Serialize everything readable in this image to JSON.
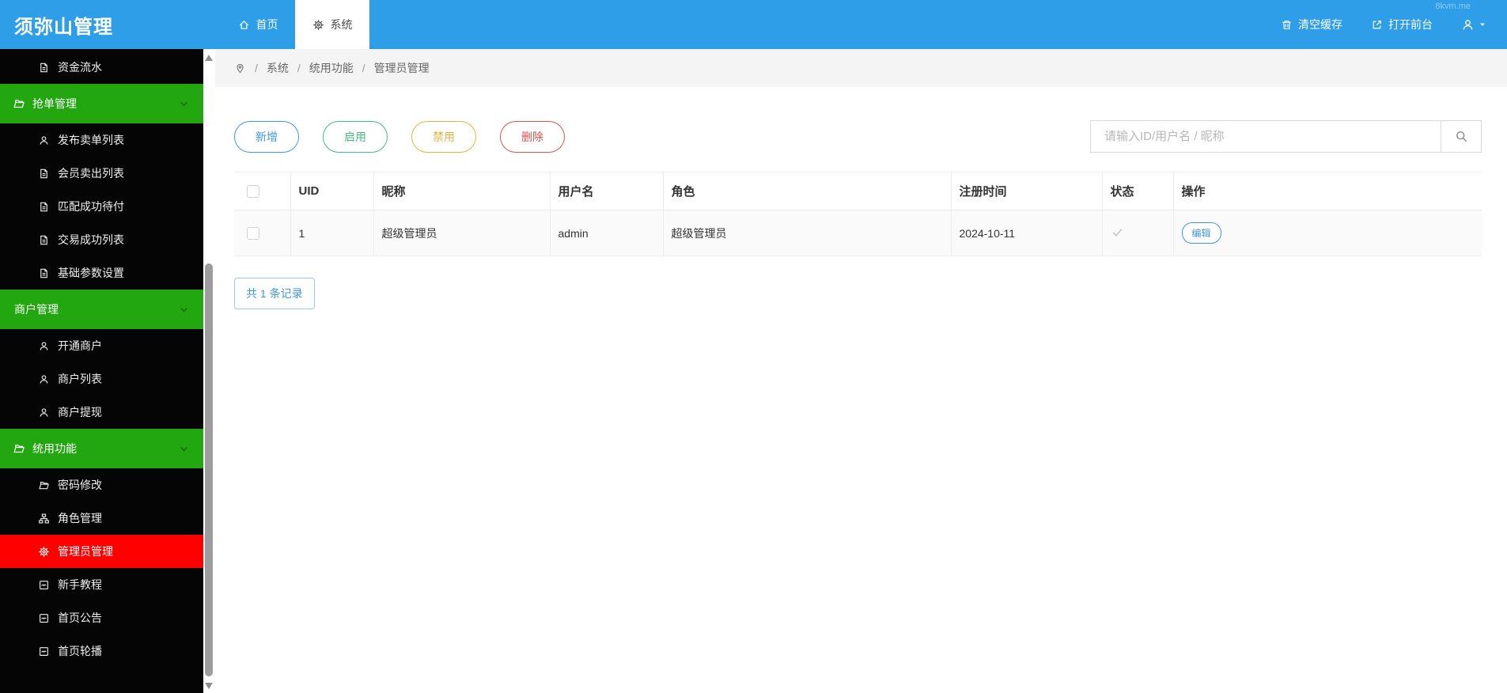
{
  "watermark": "8kvm.me",
  "colors": {
    "header_blue": "#2e9ee9",
    "sidebar_section_green": "#22a710",
    "sidebar_active_red": "#fe0000",
    "btn_add_blue": "#3e97df",
    "btn_enable_green": "#42bd80",
    "btn_disable_amber": "#e2b33c",
    "btn_delete_red": "#d9534f"
  },
  "header": {
    "logo": "须弥山管理",
    "tabs": [
      {
        "label": "首页",
        "icon": "home-icon",
        "active": false
      },
      {
        "label": "系统",
        "icon": "gear-icon",
        "active": true
      }
    ],
    "actions": [
      {
        "label": "清空缓存",
        "icon": "trash-icon"
      },
      {
        "label": "打开前台",
        "icon": "external-link-icon"
      }
    ],
    "user_menu": {
      "icon": "user-icon",
      "caret": "caret-down-icon"
    }
  },
  "sidebar": {
    "items": [
      {
        "label": "资金流水",
        "icon": "file-icon",
        "type": "item"
      },
      {
        "label": "抢单管理",
        "icon": "folder-open-icon",
        "type": "section"
      },
      {
        "label": "发布卖单列表",
        "icon": "person-icon",
        "type": "item"
      },
      {
        "label": "会员卖出列表",
        "icon": "file-icon",
        "type": "item"
      },
      {
        "label": "匹配成功待付",
        "icon": "file-icon",
        "type": "item"
      },
      {
        "label": "交易成功列表",
        "icon": "file-icon",
        "type": "item"
      },
      {
        "label": "基础参数设置",
        "icon": "file-icon",
        "type": "item"
      },
      {
        "label": "商户管理",
        "icon": null,
        "type": "section"
      },
      {
        "label": "开通商户",
        "icon": "person-icon",
        "type": "item"
      },
      {
        "label": "商户列表",
        "icon": "person-icon",
        "type": "item"
      },
      {
        "label": "商户提现",
        "icon": "person-icon",
        "type": "item"
      },
      {
        "label": "统用功能",
        "icon": "folder-open-icon",
        "type": "section"
      },
      {
        "label": "密码修改",
        "icon": "folder-open-icon",
        "type": "item"
      },
      {
        "label": "角色管理",
        "icon": "sitemap-icon",
        "type": "item"
      },
      {
        "label": "管理员管理",
        "icon": "gear-icon",
        "type": "item",
        "active": true
      },
      {
        "label": "新手教程",
        "icon": "bulletin-icon",
        "type": "item"
      },
      {
        "label": "首页公告",
        "icon": "bulletin-icon",
        "type": "item"
      },
      {
        "label": "首页轮播",
        "icon": "bulletin-icon",
        "type": "item"
      }
    ]
  },
  "breadcrumb": {
    "separator": "/",
    "items": [
      "系统",
      "统用功能",
      "管理员管理"
    ]
  },
  "toolbar": {
    "buttons": [
      {
        "label": "新增",
        "color": "#3e97df"
      },
      {
        "label": "启用",
        "color": "#42bd80"
      },
      {
        "label": "禁用",
        "color": "#e2b33c"
      },
      {
        "label": "删除",
        "color": "#d9534f"
      }
    ],
    "search_placeholder": "请输入ID/用户名 / 昵称"
  },
  "table": {
    "columns": [
      "UID",
      "昵称",
      "用户名",
      "角色",
      "注册时间",
      "状态",
      "操作"
    ],
    "rows": [
      {
        "uid": "1",
        "nickname": "超级管理员",
        "username": "admin",
        "role": "超级管理员",
        "reg_time": "2024-10-11",
        "status": "checked",
        "action": "编辑"
      }
    ]
  },
  "footer": {
    "total": "共 1 条记录"
  }
}
